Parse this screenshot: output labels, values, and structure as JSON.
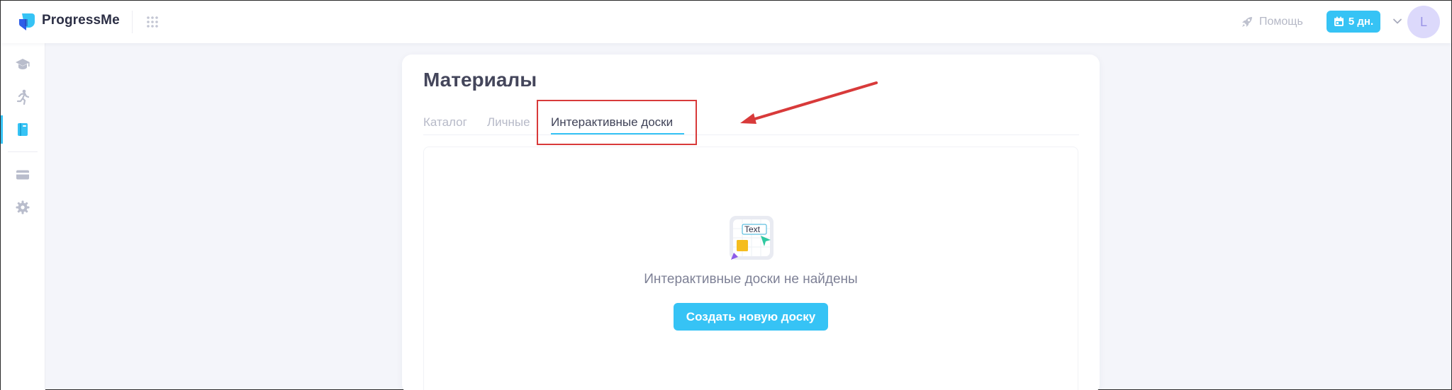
{
  "app": {
    "brand": "ProgressMe"
  },
  "header": {
    "help_label": "Помощь",
    "days_label": "5 дн.",
    "avatar_letter": "L"
  },
  "sidebar": {
    "items": [
      {
        "icon": "graduation-cap-icon"
      },
      {
        "icon": "running-person-icon"
      },
      {
        "icon": "book-icon",
        "active": true
      },
      {
        "icon": "card-icon"
      },
      {
        "icon": "gear-icon"
      }
    ]
  },
  "main": {
    "title": "Материалы",
    "tabs": [
      {
        "label": "Каталог"
      },
      {
        "label": "Личные"
      },
      {
        "label": "Интерактивные доски",
        "active": true
      }
    ],
    "empty_state": {
      "icon_text": "Text",
      "message": "Интерактивные доски не найдены",
      "button_label": "Создать новую доску"
    }
  },
  "colors": {
    "accent": "#36c3f5",
    "annotation": "#d83a3a",
    "title": "#44465b"
  }
}
